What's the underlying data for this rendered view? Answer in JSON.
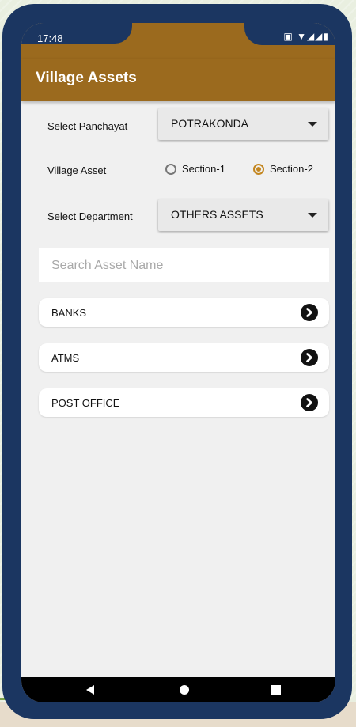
{
  "status_bar": {
    "time": "17:48",
    "icons_text": "▣ ▼◢◢▮"
  },
  "app": {
    "title": "Village Assets"
  },
  "form": {
    "panchayat_label": "Select Panchayat",
    "panchayat_value": "POTRAKONDA",
    "village_asset_label": "Village Asset",
    "section1_label": "Section-1",
    "section2_label": "Section-2",
    "selected_section": "Section-2",
    "department_label": "Select Department",
    "department_value": "OTHERS ASSETS"
  },
  "search": {
    "placeholder": "Search Asset Name"
  },
  "assets": [
    {
      "label": "BANKS"
    },
    {
      "label": "ATMS"
    },
    {
      "label": "POST OFFICE"
    }
  ],
  "colors": {
    "app_bar": "#9b6a1e",
    "frame": "#1b3661",
    "radio_accent": "#c3861f"
  },
  "icons": [
    "arrow-right-circle-icon",
    "back-icon",
    "home-icon",
    "recents-icon"
  ]
}
